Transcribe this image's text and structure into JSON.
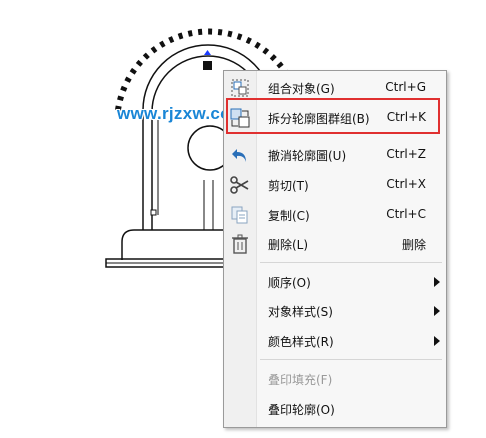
{
  "watermark": "www.rjzxw.com",
  "context_menu": {
    "items": [
      {
        "label": "组合对象(G)",
        "shortcut": "Ctrl+G",
        "icon": "group-objects-icon"
      },
      {
        "label": "拆分轮廓图群组(B)",
        "shortcut": "Ctrl+K",
        "icon": "break-contour-group-icon"
      },
      {
        "label": "撤消轮廓圖(U)",
        "shortcut": "Ctrl+Z",
        "icon": "undo-icon"
      },
      {
        "label": "剪切(T)",
        "shortcut": "Ctrl+X",
        "icon": "scissors-icon"
      },
      {
        "label": "复制(C)",
        "shortcut": "Ctrl+C",
        "icon": "copy-icon"
      },
      {
        "label": "删除(L)",
        "shortcut": "删除",
        "icon": "trash-icon"
      },
      {
        "label": "顺序(O)",
        "submenu": true
      },
      {
        "label": "对象样式(S)",
        "submenu": true
      },
      {
        "label": "颜色样式(R)",
        "submenu": true
      },
      {
        "label": "叠印填充(F)",
        "disabled": true
      },
      {
        "label": "叠印轮廓(O)"
      }
    ],
    "highlighted_item": "拆分轮廓图群组(B)",
    "highlight_color": "#e03030"
  },
  "colors": {
    "watermark": "#1a86d6",
    "selection_handle": "#1a3cff",
    "icon_blue": "#2a6fb8"
  }
}
